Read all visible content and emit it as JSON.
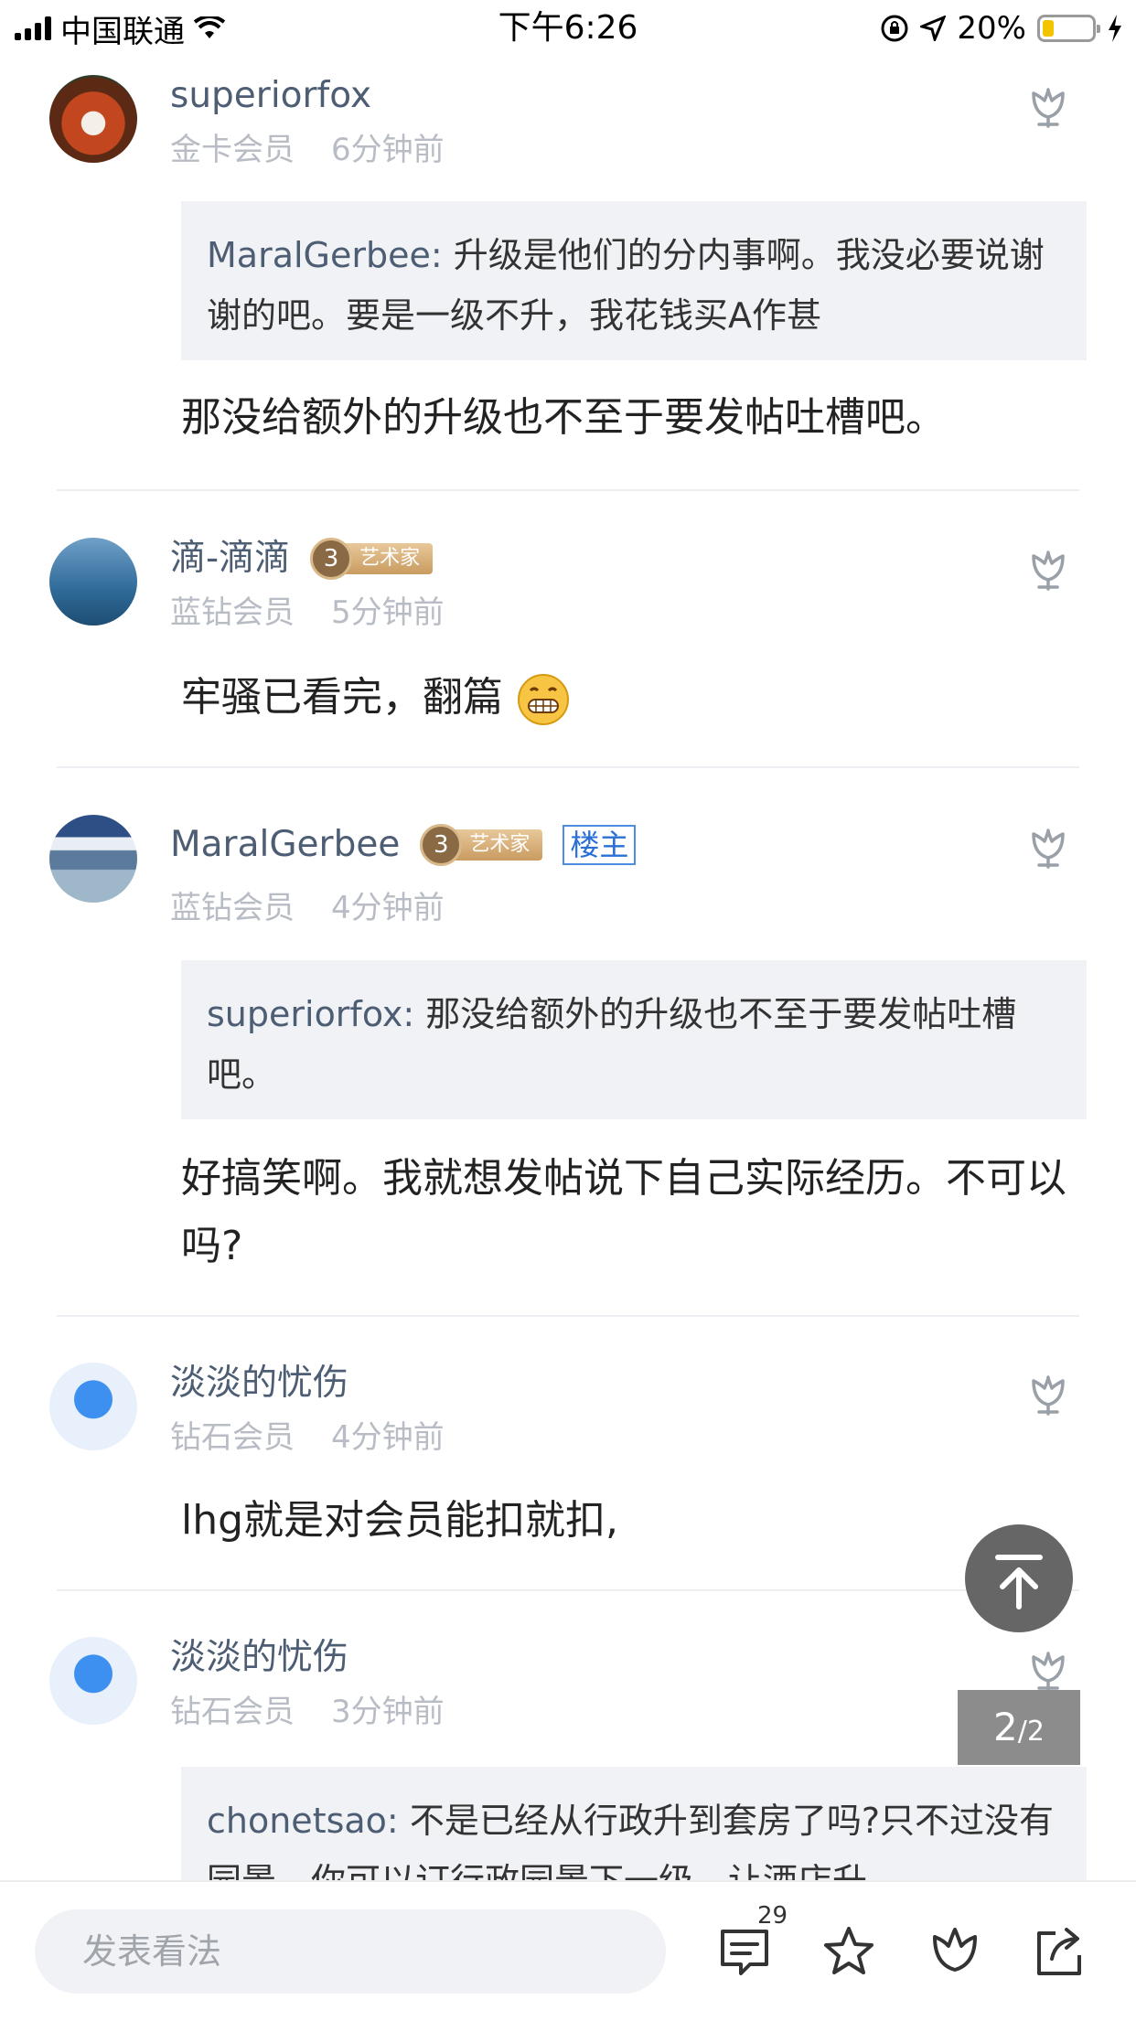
{
  "status_bar": {
    "carrier": "中国联通",
    "time": "下午6:26",
    "battery_percent": "20%"
  },
  "comments": [
    {
      "username": "superiorfox",
      "level": "金卡会员",
      "time": "6分钟前",
      "quote": {
        "user": "MaralGerbee:",
        "text": "升级是他们的分内事啊。我没必要说谢谢的吧。要是一级不升，我花钱买A作甚"
      },
      "text": "那没给额外的升级也不至于要发帖吐槽吧。"
    },
    {
      "username": "滴-滴滴",
      "badge_level": "3",
      "badge_label": "艺术家",
      "level": "蓝钻会员",
      "time": "5分钟前",
      "text": "牢骚已看完，翻篇"
    },
    {
      "username": "MaralGerbee",
      "badge_level": "3",
      "badge_label": "艺术家",
      "owner_tag": "楼主",
      "level": "蓝钻会员",
      "time": "4分钟前",
      "quote": {
        "user": "superiorfox:",
        "text": "那没给额外的升级也不至于要发帖吐槽吧。"
      },
      "text": "好搞笑啊。我就想发帖说下自己实际经历。不可以吗?"
    },
    {
      "username": "淡淡的忧伤",
      "level": "钻石会员",
      "time": "4分钟前",
      "text": "lhg就是对会员能扣就扣,"
    },
    {
      "username": "淡淡的忧伤",
      "level": "钻石会员",
      "time": "3分钟前",
      "quote": {
        "user": "chonetsao:",
        "text": "不是已经从行政升到套房了吗?只不过没有园景，你可以订行政园景下一级，让酒店升"
      }
    }
  ],
  "page_indicator": {
    "current": "2",
    "total": "/2"
  },
  "bottom_bar": {
    "input_placeholder": "发表看法",
    "comment_count": "29"
  },
  "colors": {
    "username": "#4d5d73",
    "meta": "#b8bcc4",
    "quote_bg": "#f1f2f5",
    "owner_tag": "#2a6fd6"
  },
  "icons": [
    "signal-icon",
    "wifi-icon",
    "lock-rotation-icon",
    "location-icon",
    "battery-icon",
    "charging-icon",
    "flower-like-icon",
    "grinning-emoji-icon",
    "arrow-up-icon",
    "comment-icon",
    "star-icon",
    "flower-icon",
    "share-icon"
  ]
}
